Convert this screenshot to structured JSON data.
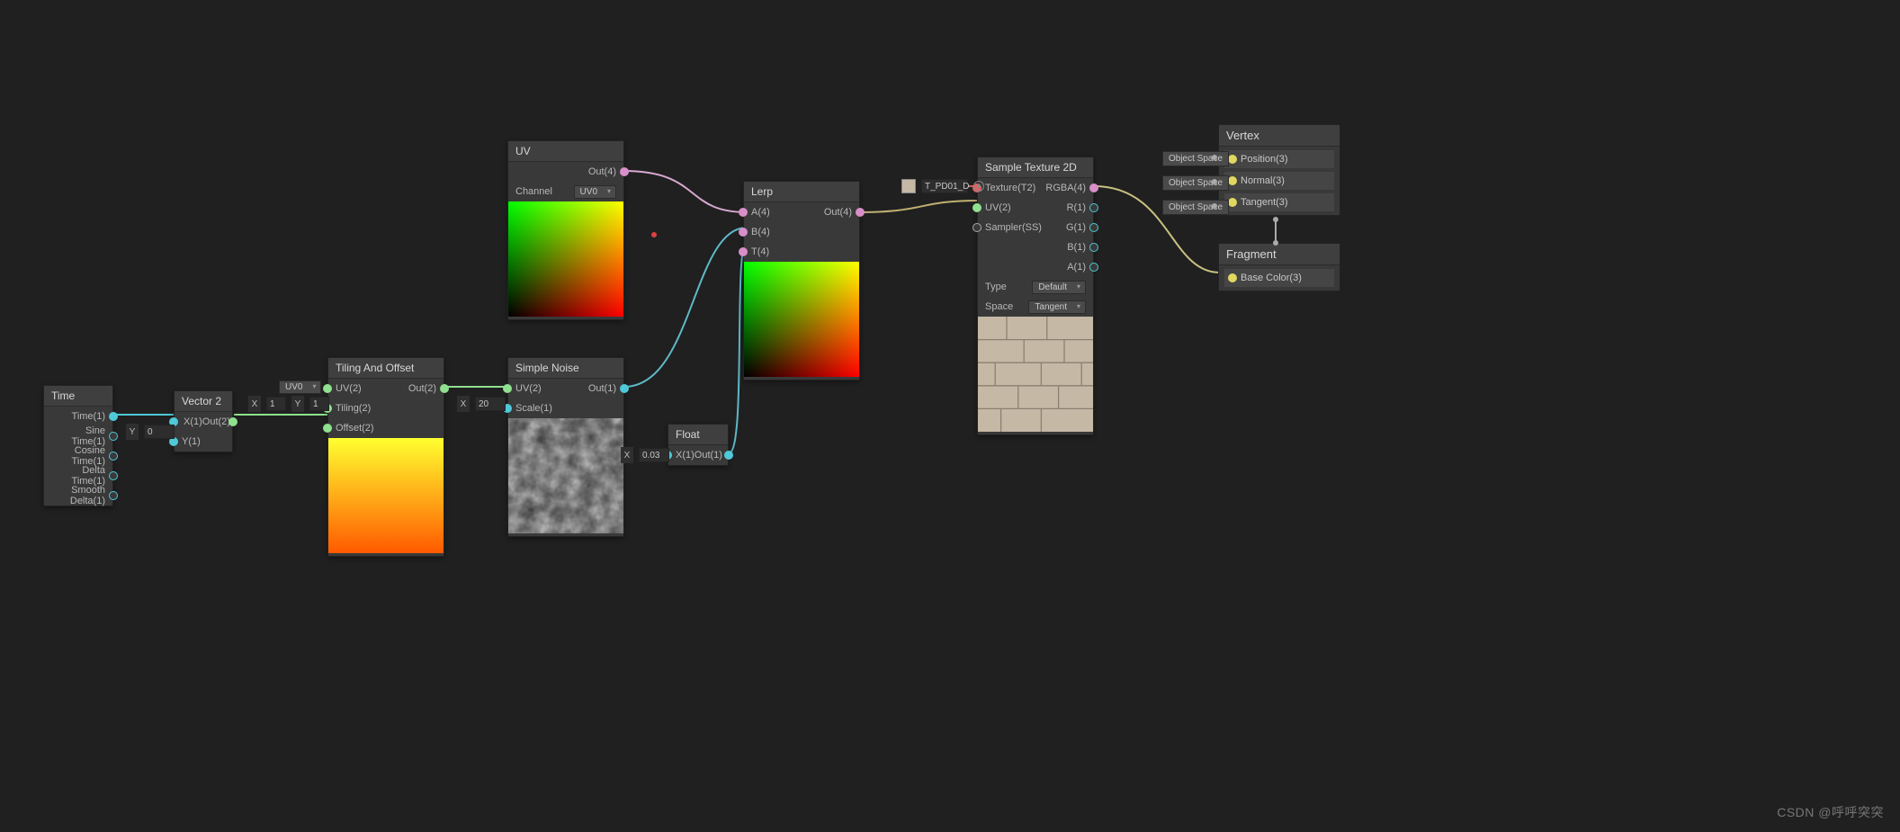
{
  "watermark": "CSDN @呼呼突突",
  "nodes": {
    "time": {
      "title": "Time",
      "outputs": [
        "Time(1)",
        "Sine Time(1)",
        "Cosine Time(1)",
        "Delta Time(1)",
        "Smooth Delta(1)"
      ]
    },
    "vector2": {
      "title": "Vector 2",
      "inputs": [
        "X(1)",
        "Y(1)"
      ],
      "output": "Out(2)",
      "y_value": "0"
    },
    "tiling": {
      "title": "Tiling And Offset",
      "uv_dropdown": "UV0",
      "inputs": [
        "UV(2)",
        "Tiling(2)",
        "Offset(2)"
      ],
      "tiling_x": "1",
      "tiling_y": "1",
      "output": "Out(2)"
    },
    "uv": {
      "title": "UV",
      "output": "Out(4)",
      "channel_label": "Channel",
      "channel_value": "UV0"
    },
    "noise": {
      "title": "Simple Noise",
      "inputs": [
        "UV(2)",
        "Scale(1)"
      ],
      "scale_value": "20",
      "output": "Out(1)"
    },
    "float": {
      "title": "Float",
      "input": "X(1)",
      "x_value": "0.03",
      "output": "Out(1)"
    },
    "lerp": {
      "title": "Lerp",
      "inputs": [
        "A(4)",
        "B(4)",
        "T(4)"
      ],
      "output": "Out(4)"
    },
    "sample": {
      "title": "Sample Texture 2D",
      "tex_chip": "T_PD01_D",
      "inputs": [
        "Texture(T2)",
        "UV(2)",
        "Sampler(SS)"
      ],
      "outputs": [
        "RGBA(4)",
        "R(1)",
        "G(1)",
        "B(1)",
        "A(1)"
      ],
      "type_label": "Type",
      "type_value": "Default",
      "space_label": "Space",
      "space_value": "Tangent"
    },
    "vertex": {
      "title": "Vertex",
      "tag": "Object Space",
      "rows": [
        "Position(3)",
        "Normal(3)",
        "Tangent(3)"
      ]
    },
    "fragment": {
      "title": "Fragment",
      "rows": [
        "Base Color(3)"
      ]
    }
  }
}
